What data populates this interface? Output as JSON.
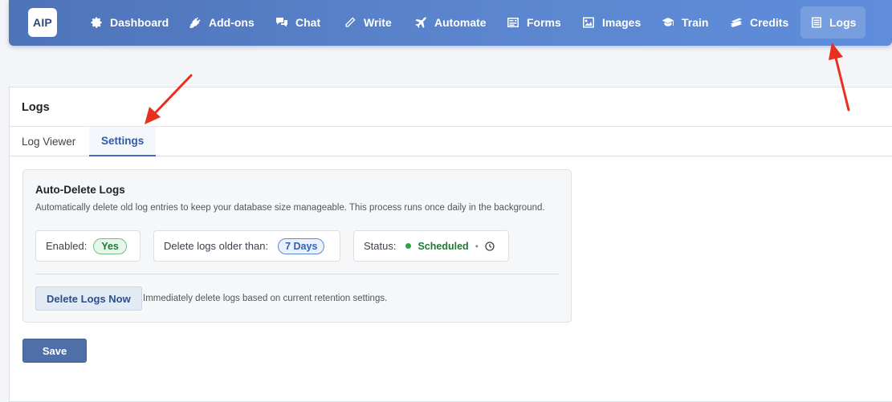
{
  "app": {
    "logo_text": "AIP"
  },
  "nav": {
    "items": [
      {
        "label": "Dashboard",
        "icon": "gear-icon"
      },
      {
        "label": "Add-ons",
        "icon": "plug-icon"
      },
      {
        "label": "Chat",
        "icon": "chat-bubbles-icon"
      },
      {
        "label": "Write",
        "icon": "pencil-icon"
      },
      {
        "label": "Automate",
        "icon": "airplane-icon"
      },
      {
        "label": "Forms",
        "icon": "form-icon"
      },
      {
        "label": "Images",
        "icon": "image-icon"
      },
      {
        "label": "Train",
        "icon": "graduation-cap-icon"
      },
      {
        "label": "Credits",
        "icon": "money-stack-icon"
      },
      {
        "label": "Logs",
        "icon": "list-icon",
        "active": true
      }
    ]
  },
  "page": {
    "title": "Logs",
    "tabs": [
      {
        "label": "Log Viewer",
        "active": false
      },
      {
        "label": "Settings",
        "active": true
      }
    ]
  },
  "settings": {
    "section_title": "Auto-Delete Logs",
    "section_description": "Automatically delete old log entries to keep your database size manageable. This process runs once daily in the background.",
    "enabled_label": "Enabled:",
    "enabled_value": "Yes",
    "older_than_label": "Delete logs older than:",
    "older_than_value": "7 Days",
    "status_label": "Status:",
    "status_value": "Scheduled",
    "delete_button": "Delete Logs Now",
    "delete_note": "Immediately delete logs based on current retention settings.",
    "save_button": "Save"
  },
  "colors": {
    "nav_gradient_start": "#4e73b8",
    "nav_gradient_end": "#5f8ddb",
    "accent": "#3d6cc0",
    "status_green": "#27a745",
    "annotation_red": "#e8301f"
  }
}
